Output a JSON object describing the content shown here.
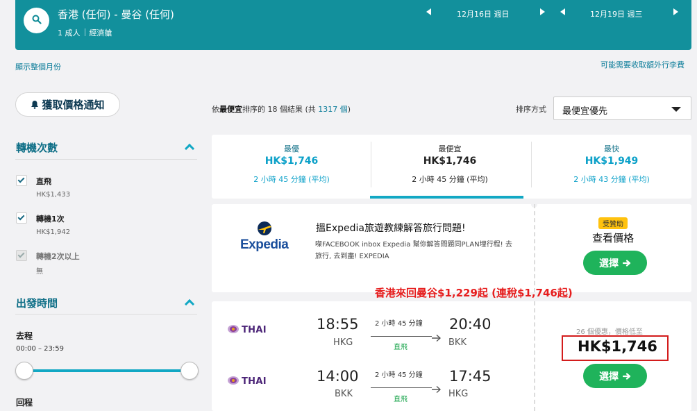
{
  "header": {
    "route": "香港 (任何) - 曼谷 (任何)",
    "passengers": "1 成人",
    "cabin": "經濟艙",
    "depart_date": "12月16日 週日",
    "return_date": "12月19日 週三"
  },
  "links": {
    "whole_month": "顯示整個月份",
    "baggage_fee": "可能需要收取額外行李費"
  },
  "price_alert": {
    "label": "獲取價格通知"
  },
  "filters": {
    "stops": {
      "title": "轉機次數",
      "options": [
        {
          "label": "直飛",
          "price": "HK$1,433",
          "checked": true
        },
        {
          "label": "轉機1次",
          "price": "HK$1,942",
          "checked": true
        },
        {
          "label": "轉機2次以上",
          "price": "無",
          "checked": true,
          "disabled": true
        }
      ]
    },
    "departure_time": {
      "title": "出發時間",
      "outbound_label": "去程",
      "outbound_range": "00:00 – 23:59",
      "return_label": "回程"
    }
  },
  "results": {
    "prefix": "依",
    "sort_key": "最便宜",
    "middle": "排序的 18 個結果 (共 ",
    "total": "1317 個",
    "suffix": ")",
    "sort_label": "排序方式",
    "sort_value": "最便宜優先"
  },
  "tabs": [
    {
      "title": "最優",
      "price": "HK$1,746",
      "duration": "2 小時 45 分鐘 (平均)"
    },
    {
      "title": "最便宜",
      "price": "HK$1,746",
      "duration": "2 小時 45 分鐘 (平均)",
      "active": true
    },
    {
      "title": "最快",
      "price": "HK$1,949",
      "duration": "2 小時 43 分鐘 (平均)"
    }
  ],
  "ad": {
    "brand": "Expedia",
    "title": "搵Expedia旅遊教練解答旅行問題!",
    "desc": "㗎FACEBOOK inbox Expedia 幫你解答問題同PLAN埋行程! 去旅行, 去到盡! EXPEDIA",
    "badge": "受贊助",
    "cta_text": "查看價格",
    "button": "選擇"
  },
  "promo_text": "香港來回曼谷$1,229起 (連稅$1,746起)",
  "flight": {
    "legs": [
      {
        "airline": "THAI",
        "depart_time": "18:55",
        "depart_code": "HKG",
        "duration": "2 小時 45 分鐘",
        "stops": "直飛",
        "arrive_time": "20:40",
        "arrive_code": "BKK"
      },
      {
        "airline": "THAI",
        "depart_time": "14:00",
        "depart_code": "BKK",
        "duration": "2 小時 45 分鐘",
        "stops": "直飛",
        "arrive_time": "17:45",
        "arrive_code": "HKG"
      }
    ],
    "deals": "26 個優惠，價格低至",
    "price": "HK$1,746",
    "button": "選擇"
  },
  "colors": {
    "header_bg": "#12909c",
    "accent": "#12a8c4",
    "select_button": "#1fb35b",
    "promo_red": "#e61e1e"
  }
}
